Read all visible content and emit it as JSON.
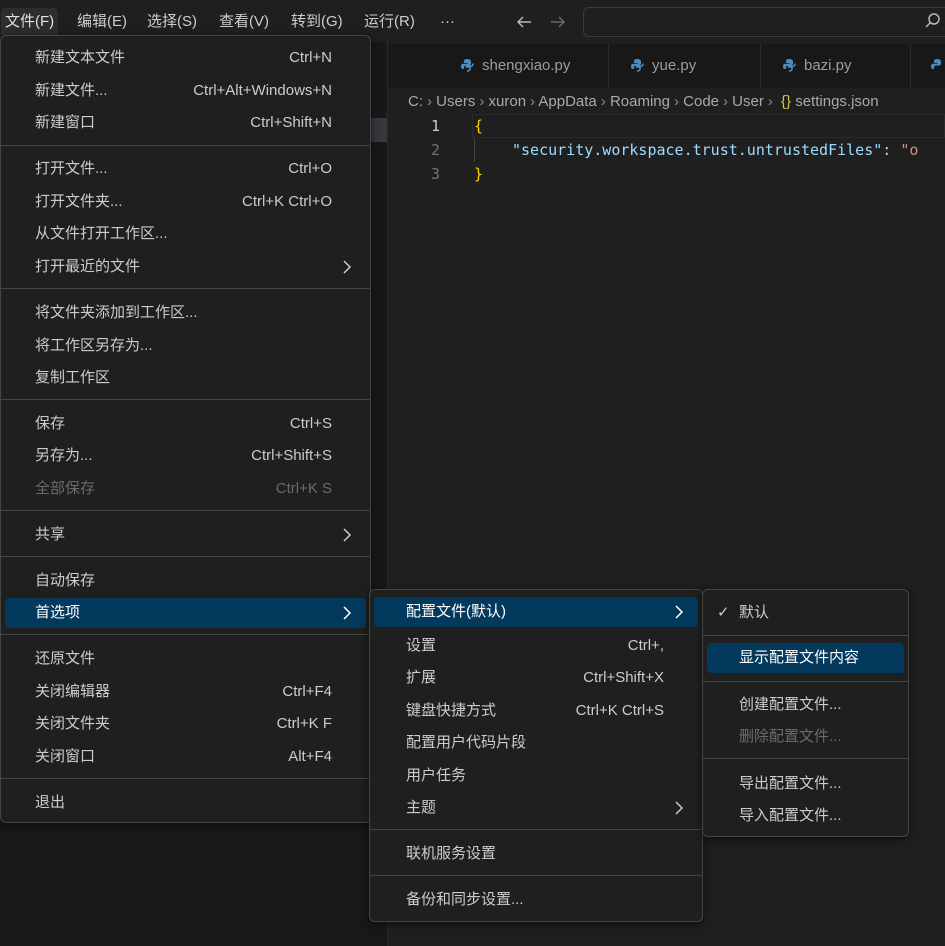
{
  "menubar": {
    "items": [
      "文件(F)",
      "编辑(E)",
      "选择(S)",
      "查看(V)",
      "转到(G)",
      "运行(R)"
    ],
    "more_label": "···"
  },
  "tabs": [
    "shengxiao.py",
    "yue.py",
    "bazi.py"
  ],
  "breadcrumbs": [
    "C:",
    "Users",
    "xuron",
    "AppData",
    "Roaming",
    "Code",
    "User",
    "settings.json"
  ],
  "breadcrumb_json_icon": "{}",
  "code": {
    "line_numbers": [
      "1",
      "2",
      "3"
    ],
    "line1": "{",
    "line2_key": "\"security.workspace.trust.untrustedFiles\"",
    "line2_colon": ": ",
    "line2_value": "\"o",
    "line3": "}"
  },
  "file_menu": {
    "groups": [
      [
        {
          "label": "新建文本文件",
          "key": "Ctrl+N"
        },
        {
          "label": "新建文件...",
          "key": "Ctrl+Alt+Windows+N"
        },
        {
          "label": "新建窗口",
          "key": "Ctrl+Shift+N"
        }
      ],
      [
        {
          "label": "打开文件...",
          "key": "Ctrl+O"
        },
        {
          "label": "打开文件夹...",
          "key": "Ctrl+K Ctrl+O"
        },
        {
          "label": "从文件打开工作区...",
          "key": ""
        },
        {
          "label": "打开最近的文件",
          "key": "",
          "submenu": true
        }
      ],
      [
        {
          "label": "将文件夹添加到工作区...",
          "key": ""
        },
        {
          "label": "将工作区另存为...",
          "key": ""
        },
        {
          "label": "复制工作区",
          "key": ""
        }
      ],
      [
        {
          "label": "保存",
          "key": "Ctrl+S"
        },
        {
          "label": "另存为...",
          "key": "Ctrl+Shift+S"
        },
        {
          "label": "全部保存",
          "key": "Ctrl+K S",
          "disabled": true
        }
      ],
      [
        {
          "label": "共享",
          "key": "",
          "submenu": true
        }
      ],
      [
        {
          "label": "自动保存",
          "key": ""
        },
        {
          "label": "首选项",
          "key": "",
          "submenu": true,
          "selected": true
        }
      ],
      [
        {
          "label": "还原文件",
          "key": ""
        },
        {
          "label": "关闭编辑器",
          "key": "Ctrl+F4"
        },
        {
          "label": "关闭文件夹",
          "key": "Ctrl+K F"
        },
        {
          "label": "关闭窗口",
          "key": "Alt+F4"
        }
      ],
      [
        {
          "label": "退出",
          "key": ""
        }
      ]
    ]
  },
  "prefs_menu": {
    "groups": [
      [
        {
          "label": "配置文件(默认)",
          "key": "",
          "submenu": true,
          "selected": true
        }
      ],
      [
        {
          "label": "设置",
          "key": "Ctrl+,"
        },
        {
          "label": "扩展",
          "key": "Ctrl+Shift+X"
        },
        {
          "label": "键盘快捷方式",
          "key": "Ctrl+K Ctrl+S"
        },
        {
          "label": "配置用户代码片段",
          "key": ""
        },
        {
          "label": "用户任务",
          "key": ""
        },
        {
          "label": "主题",
          "key": "",
          "submenu": true
        }
      ],
      [
        {
          "label": "联机服务设置",
          "key": ""
        }
      ],
      [
        {
          "label": "备份和同步设置...",
          "key": ""
        }
      ]
    ]
  },
  "profile_menu": {
    "groups": [
      [
        {
          "label": "默认",
          "checked": true
        }
      ],
      [
        {
          "label": "显示配置文件内容",
          "selected": true
        }
      ],
      [
        {
          "label": "创建配置文件..."
        },
        {
          "label": "删除配置文件...",
          "disabled": true
        }
      ],
      [
        {
          "label": "导出配置文件..."
        },
        {
          "label": "导入配置文件..."
        }
      ]
    ]
  },
  "colors": {
    "selection": "#04395e",
    "json_brace": "#ffd700",
    "json_key": "#9cdcfe",
    "json_string": "#ce9178",
    "python_icon": "#4b8bbe"
  }
}
